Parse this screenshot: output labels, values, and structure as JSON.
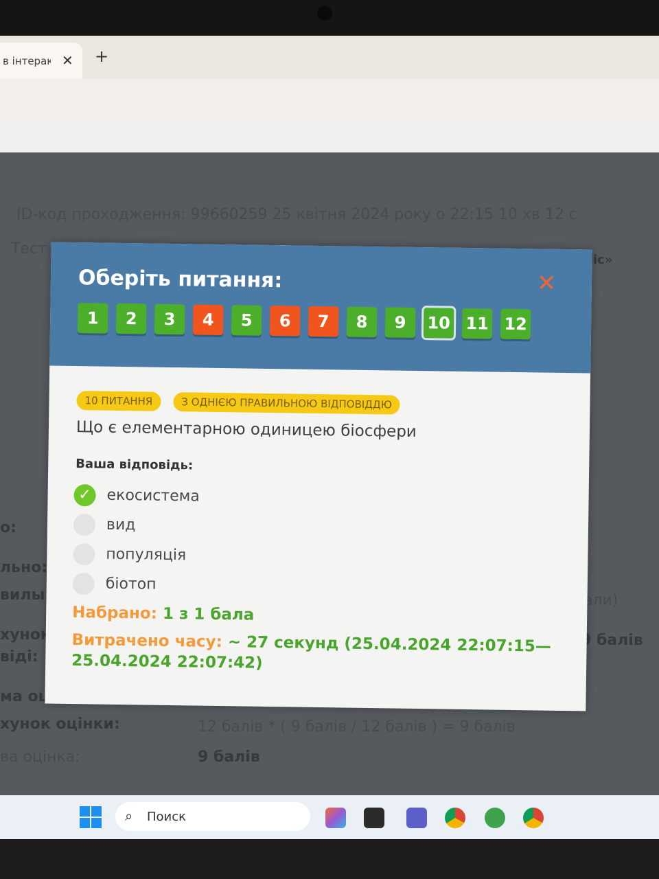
{
  "browser": {
    "tab_title": "в інтерак",
    "close": "✕",
    "new_tab": "+"
  },
  "background": {
    "line1": "ID-код проходження: 99660259    25 квітня 2024 року о 22:15 10 хв 12 с",
    "test_label": "Тест",
    "right_frag": "іс»",
    "l1": "о:",
    "l2": "льно:",
    "l3": "вилы",
    "l4": "хунок",
    "l5": "віді:",
    "l6": "ма оц",
    "l7": "хунок оцінки:",
    "l8": "ва оцінка:",
    "r1": "али)",
    "r2": "9 балів",
    "calc": "12 балів * ( 9 балів  /  12 балів ) = 9 балів",
    "final": "9 балів"
  },
  "modal": {
    "title": "Оберіть питання:",
    "questions": [
      {
        "n": "1",
        "status": "green"
      },
      {
        "n": "2",
        "status": "green"
      },
      {
        "n": "3",
        "status": "green"
      },
      {
        "n": "4",
        "status": "orange"
      },
      {
        "n": "5",
        "status": "green"
      },
      {
        "n": "6",
        "status": "orange"
      },
      {
        "n": "7",
        "status": "orange"
      },
      {
        "n": "8",
        "status": "green"
      },
      {
        "n": "9",
        "status": "green"
      },
      {
        "n": "10",
        "status": "green",
        "active": true
      },
      {
        "n": "11",
        "status": "green"
      },
      {
        "n": "12",
        "status": "green"
      }
    ],
    "badge_number": "10 ПИТАННЯ",
    "badge_type": "З ОДНІЄЮ ПРАВИЛЬНОЮ ВІДПОВІДДЮ",
    "question": "Що є елементарною одиницею біосфери",
    "answer_label": "Ваша відповідь:",
    "options": [
      {
        "text": "екосистема",
        "checked": true
      },
      {
        "text": "вид",
        "checked": false
      },
      {
        "text": "популяція",
        "checked": false
      },
      {
        "text": "біотоп",
        "checked": false
      }
    ],
    "score_label": "Набрано:",
    "score_value": "1 з 1 бала",
    "time_label": "Витрачено часу:",
    "time_value": "~ 27 секунд (25.04.2024 22:07:15—25.04.2024 22:07:42)"
  },
  "taskbar": {
    "search_text": "Поиск"
  },
  "colors": {
    "green": "#4caf2a",
    "orange": "#f0551e",
    "header": "#4a7ba7"
  }
}
